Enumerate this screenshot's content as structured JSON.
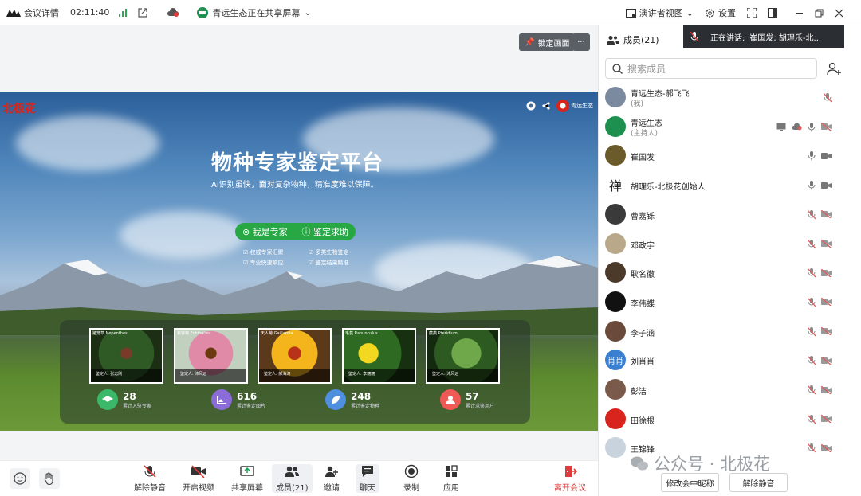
{
  "topbar": {
    "app_label": "会议详情",
    "time": "02:11:40",
    "sharing_status": "青远生态正在共享屏幕",
    "speaker_view": "演讲者视图",
    "settings": "设置"
  },
  "stage": {
    "lock_label": "锁定画面",
    "more": "···"
  },
  "slide": {
    "brand": "北极花",
    "org": "青远生态",
    "title": "物种专家鉴定平台",
    "subtitle": "AI识别虽快，面对复杂物种，精准度难以保障。",
    "buttons": [
      "我是专家",
      "鉴定求助"
    ],
    "features": [
      "权威专家汇聚",
      "多类生物鉴定",
      "专业快速响应",
      "鉴定结果精准"
    ],
    "cards": [
      {
        "tag": "猪笼草 Nepenthes",
        "foot": "鉴定人: 张志刚"
      },
      {
        "tag": "紫锥菊 Echinacea",
        "foot": "鉴定人: 沐风远"
      },
      {
        "tag": "天人菊 Gaillardia",
        "foot": "鉴定人: 郝海涛"
      },
      {
        "tag": "毛茛 Ranunculus",
        "foot": "鉴定人: 李丽丽"
      },
      {
        "tag": "蕨类 Pteridium",
        "foot": "鉴定人: 沐风远"
      }
    ],
    "stats": [
      {
        "num": "28",
        "cap": "累计入驻专家",
        "color": "#3cb86a"
      },
      {
        "num": "616",
        "cap": "累计鉴定图片",
        "color": "#8b6cd9"
      },
      {
        "num": "248",
        "cap": "累计鉴定物种",
        "color": "#4f8fe0"
      },
      {
        "num": "57",
        "cap": "累计求鉴用户",
        "color": "#ee5a55"
      }
    ]
  },
  "toolbar": {
    "unmute": "解除静音",
    "video": "开启视频",
    "share": "共享屏幕",
    "members": "成员(21)",
    "invite": "邀请",
    "chat": "聊天",
    "record": "录制",
    "apps": "应用",
    "leave": "离开会议"
  },
  "sidebar": {
    "header": "成员(21)",
    "speaking_label": "正在讲话:",
    "speaking_names": "崔国发; 胡理乐-北...",
    "search_placeholder": "搜索成员",
    "members": [
      {
        "name": "青远生态-郝飞飞",
        "role": "(我)"
      },
      {
        "name": "青远生态",
        "role": "(主持人)"
      },
      {
        "name": "崔国发",
        "role": ""
      },
      {
        "name": "胡理乐-北极花创始人",
        "role": ""
      },
      {
        "name": "曹嘉铄",
        "role": ""
      },
      {
        "name": "邓政宇",
        "role": ""
      },
      {
        "name": "耿名徽",
        "role": ""
      },
      {
        "name": "李伟蝶",
        "role": ""
      },
      {
        "name": "李子涵",
        "role": ""
      },
      {
        "name": "刘肖肖",
        "role": "",
        "avatar_text": "肖肖"
      },
      {
        "name": "彭洁",
        "role": ""
      },
      {
        "name": "田徐根",
        "role": ""
      },
      {
        "name": "王锦锋",
        "role": ""
      }
    ],
    "footer": {
      "rename": "修改会中昵称",
      "unmute": "解除静音"
    }
  },
  "watermark": {
    "text": "公众号 · 北极花"
  }
}
